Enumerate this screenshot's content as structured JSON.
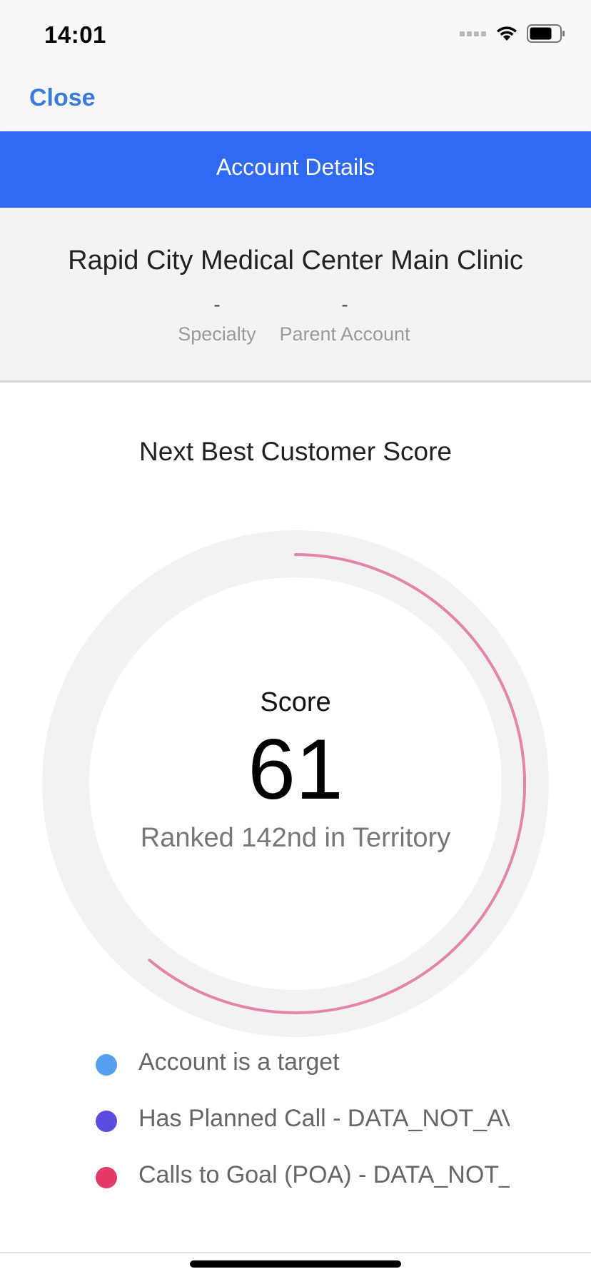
{
  "status_bar": {
    "time": "14:01",
    "signal_icon": "signal-dots-icon",
    "wifi_icon": "wifi-icon",
    "battery_icon": "battery-icon"
  },
  "nav": {
    "close_label": "Close"
  },
  "header": {
    "title": "Account Details"
  },
  "account": {
    "name": "Rapid City Medical Center Main Clinic",
    "specialty_value": "-",
    "specialty_label": "Specialty",
    "parent_value": "-",
    "parent_label": "Parent Account"
  },
  "score_section": {
    "title": "Next Best Customer Score",
    "score_label": "Score",
    "score_value": "61",
    "score_fraction": 0.61,
    "rank_text": "Ranked 142nd in Territory",
    "colors": {
      "track": "#f2f2f2",
      "arc": "#e384aa"
    }
  },
  "legend": [
    {
      "label": "Account is a target",
      "color": "#58a0ef"
    },
    {
      "label": "Has Planned Call  - DATA_NOT_AVAILABLE",
      "color": "#5b4ce0"
    },
    {
      "label": "Calls to Goal (POA)  - DATA_NOT_AVAILABLE",
      "color": "#e43a68"
    }
  ]
}
